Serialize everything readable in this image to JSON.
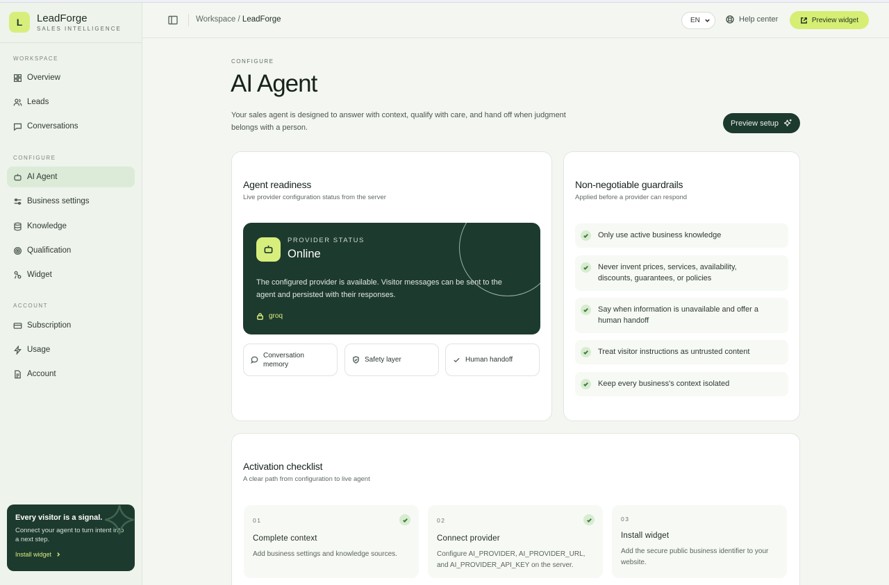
{
  "brand": {
    "logo_letter": "L",
    "name": "LeadForge",
    "tagline": "SALES INTELLIGENCE"
  },
  "sidebar": {
    "sections": {
      "workspace": "WORKSPACE",
      "configure": "CONFIGURE",
      "account": "ACCOUNT"
    },
    "items": [
      {
        "label": "Overview",
        "icon": "grid-icon"
      },
      {
        "label": "Leads",
        "icon": "users-icon"
      },
      {
        "label": "Conversations",
        "icon": "chat-icon"
      },
      {
        "label": "AI Agent",
        "icon": "bot-icon",
        "active": true
      },
      {
        "label": "Business settings",
        "icon": "sliders-icon"
      },
      {
        "label": "Knowledge",
        "icon": "database-icon"
      },
      {
        "label": "Qualification",
        "icon": "target-icon"
      },
      {
        "label": "Widget",
        "icon": "widget-icon"
      },
      {
        "label": "Subscription",
        "icon": "card-icon"
      },
      {
        "label": "Usage",
        "icon": "bolt-icon"
      },
      {
        "label": "Account",
        "icon": "document-icon"
      }
    ],
    "promo": {
      "title": "Every visitor is a signal.",
      "text": "Connect your agent to turn intent into a next step.",
      "link": "Install widget"
    }
  },
  "header": {
    "breadcrumb_root": "Workspace",
    "breadcrumb_sep": "/",
    "breadcrumb_current": "LeadForge",
    "language": "EN",
    "help": "Help center",
    "preview_widget": "Preview widget"
  },
  "page": {
    "eyebrow": "CONFIGURE",
    "title": "AI Agent",
    "description": "Your sales agent is designed to answer with context, qualify with care, and hand off when judgment belongs with a person.",
    "preview_setup": "Preview setup"
  },
  "readiness": {
    "title": "Agent readiness",
    "subtitle": "Live provider configuration status from the server",
    "status_label": "PROVIDER STATUS",
    "status_value": "Online",
    "status_text": "The configured provider is available. Visitor messages can be sent to the agent and persisted with their responses.",
    "provider": "groq",
    "chips": [
      "Conversation memory",
      "Safety layer",
      "Human handoff"
    ]
  },
  "guardrails": {
    "title": "Non-negotiable guardrails",
    "subtitle": "Applied before a provider can respond",
    "items": [
      "Only use active business knowledge",
      "Never invent prices, services, availability, discounts, guarantees, or policies",
      "Say when information is unavailable and offer a human handoff",
      "Treat visitor instructions as untrusted content",
      "Keep every business's context isolated"
    ]
  },
  "checklist": {
    "title": "Activation checklist",
    "subtitle": "A clear path from configuration to live agent",
    "steps": [
      {
        "num": "01",
        "title": "Complete context",
        "desc": "Add business settings and knowledge sources.",
        "done": true
      },
      {
        "num": "02",
        "title": "Connect provider",
        "desc": "Configure AI_PROVIDER, AI_PROVIDER_URL, and AI_PROVIDER_API_KEY on the server.",
        "done": true
      },
      {
        "num": "03",
        "title": "Install widget",
        "desc": "Add the secure public business identifier to your website.",
        "done": false
      }
    ]
  }
}
